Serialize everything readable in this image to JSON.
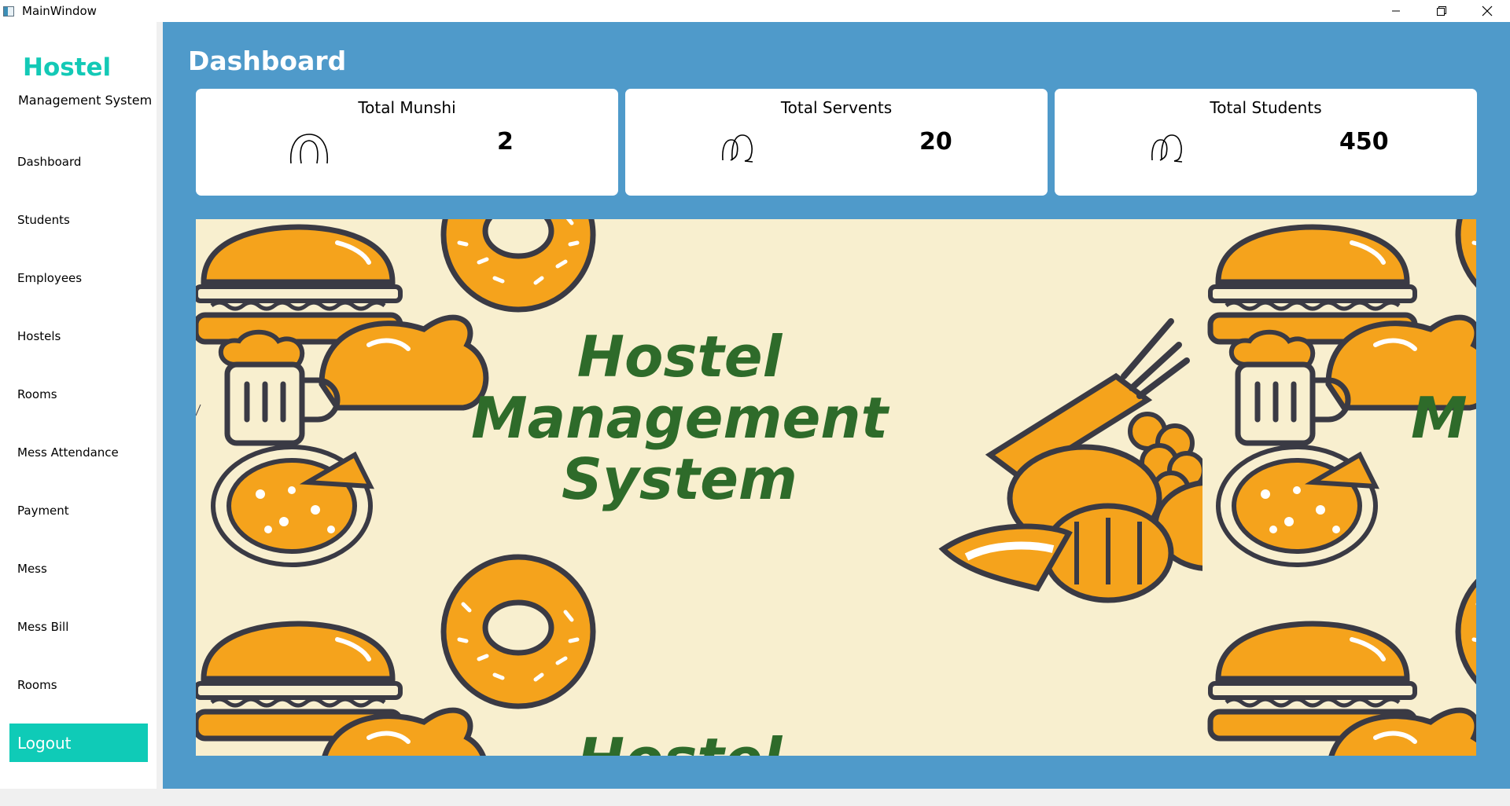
{
  "window": {
    "title": "MainWindow",
    "controls": [
      "minimize-icon",
      "restore-icon",
      "close-icon"
    ]
  },
  "sidebar": {
    "brand": "Hostel",
    "subtitle": "Management System",
    "items": [
      {
        "label": "Dashboard"
      },
      {
        "label": "Students"
      },
      {
        "label": "Employees"
      },
      {
        "label": "Hostels"
      },
      {
        "label": "Rooms"
      },
      {
        "label": "Mess Attendance"
      },
      {
        "label": "Payment"
      },
      {
        "label": "Mess"
      },
      {
        "label": "Mess Bill"
      },
      {
        "label": "Rooms"
      }
    ],
    "logout_label": "Logout"
  },
  "main": {
    "title": "Dashboard",
    "cards": [
      {
        "title": "Total Munshi",
        "value": "2",
        "icon": "user-icon"
      },
      {
        "title": "Total Servents",
        "value": "20",
        "icon": "users-icon"
      },
      {
        "title": "Total Students",
        "value": "450",
        "icon": "users-icon"
      }
    ],
    "banner": {
      "line1": "Hostel",
      "line2": "Management",
      "line3": "System",
      "partial_right": "M",
      "partial_bottom": "Hostel"
    }
  },
  "colors": {
    "accent": "#0fcbb7",
    "brand_text": "#13c9b6",
    "main_bg": "#4f9aca",
    "banner_bg": "#f8efcf",
    "banner_text": "#2e6b2a",
    "food_orange": "#f5a31c",
    "food_outline": "#3a3a44"
  }
}
